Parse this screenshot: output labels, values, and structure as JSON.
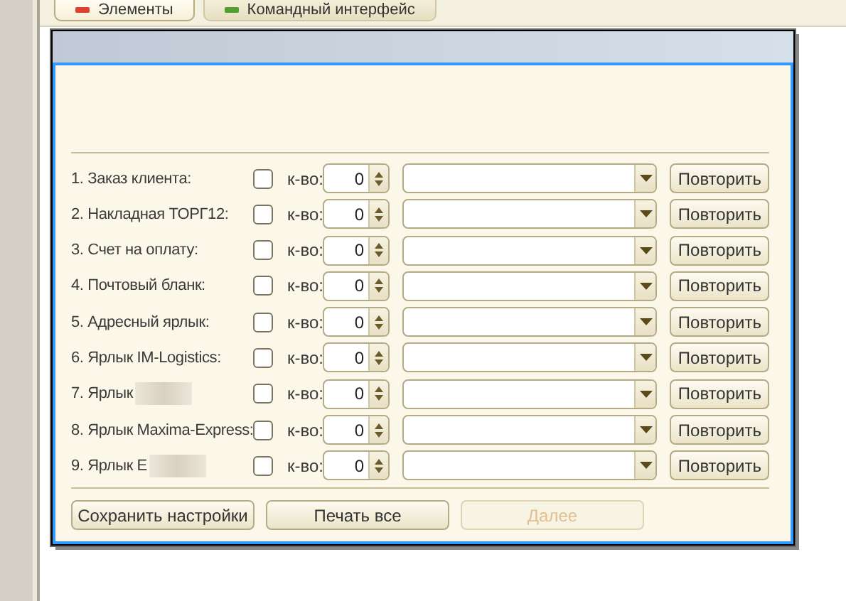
{
  "tabs": [
    {
      "label": "Элементы",
      "selected": true,
      "color": "#e04030"
    },
    {
      "label": "Командный интерфейс",
      "selected": false,
      "color": "#50a030"
    }
  ],
  "rows": [
    {
      "label": "1. Заказ клиента:",
      "redacted": false,
      "checked": false,
      "qty_label": "к-во:",
      "quantity": "0",
      "button": "Повторить"
    },
    {
      "label": "2. Накладная ТОРГ12:",
      "redacted": false,
      "checked": false,
      "qty_label": "к-во:",
      "quantity": "0",
      "button": "Повторить"
    },
    {
      "label": "3. Счет на оплату:",
      "redacted": false,
      "checked": false,
      "qty_label": "к-во:",
      "quantity": "0",
      "button": "Повторить"
    },
    {
      "label": "4. Почтовый бланк:",
      "redacted": false,
      "checked": false,
      "qty_label": "к-во:",
      "quantity": "0",
      "button": "Повторить"
    },
    {
      "label": "5. Адресный ярлык:",
      "redacted": false,
      "checked": false,
      "qty_label": "к-во:",
      "quantity": "0",
      "button": "Повторить"
    },
    {
      "label": "6. Ярлык IM-Logistics:",
      "redacted": false,
      "checked": false,
      "qty_label": "к-во:",
      "quantity": "0",
      "button": "Повторить"
    },
    {
      "label": "7. Ярлык",
      "redacted": true,
      "checked": false,
      "qty_label": "к-во:",
      "quantity": "0",
      "button": "Повторить"
    },
    {
      "label": "8. Ярлык Maxima-Express:",
      "redacted": false,
      "checked": false,
      "qty_label": "к-во:",
      "quantity": "0",
      "button": "Повторить"
    },
    {
      "label": "9. Ярлык Е",
      "redacted": true,
      "checked": false,
      "qty_label": "к-во:",
      "quantity": "0",
      "button": "Повторить"
    }
  ],
  "footer_buttons": [
    {
      "label": "Сохранить настройки",
      "disabled": false
    },
    {
      "label": "Печать все",
      "disabled": false
    },
    {
      "label": "Далее",
      "disabled": true
    }
  ]
}
